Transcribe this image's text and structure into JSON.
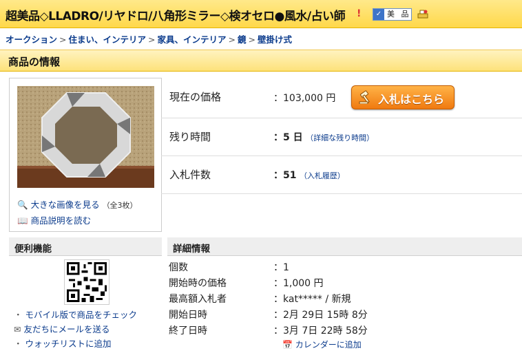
{
  "title": "超美品◇LLADRO/リヤドロ/八角形ミラー◇検オセロ●風水/占い師",
  "title_badge": "美 品",
  "breadcrumb": [
    "オークション",
    "住まい、インテリア",
    "家具、インテリア",
    "鏡",
    "壁掛け式"
  ],
  "section_title": "商品の情報",
  "image_panel": {
    "large_image_link": "大きな画像を見る",
    "large_image_count": "（全3枚）",
    "description_link": "商品説明を読む"
  },
  "price": {
    "label": "現在の価格",
    "value": "：103,000 円",
    "bid_button": "入札はこちら"
  },
  "time_left": {
    "label": "残り時間",
    "value": "：5 日",
    "detail_link": "（詳細な残り時間）"
  },
  "bids": {
    "label": "入札件数",
    "value": "：51",
    "history_link": "（入札履歴）"
  },
  "tools": {
    "title": "便利機能",
    "mobile_link": "モバイル版で商品をチェック",
    "mail_link": "友だちにメールを送る",
    "watch_link": "ウォッチリストに追加"
  },
  "details": {
    "title": "詳細情報",
    "rows": [
      {
        "label": "個数",
        "value": "：1"
      },
      {
        "label": "開始時の価格",
        "value": "：1,000 円"
      },
      {
        "label": "最高額入札者",
        "value": "：kat***** / 新規"
      },
      {
        "label": "開始日時",
        "value": "：2月 29日 15時 8分"
      },
      {
        "label": "終了日時",
        "value": "：3月 7日 22時 58分"
      }
    ],
    "calendar_link": "カレンダーに追加"
  }
}
